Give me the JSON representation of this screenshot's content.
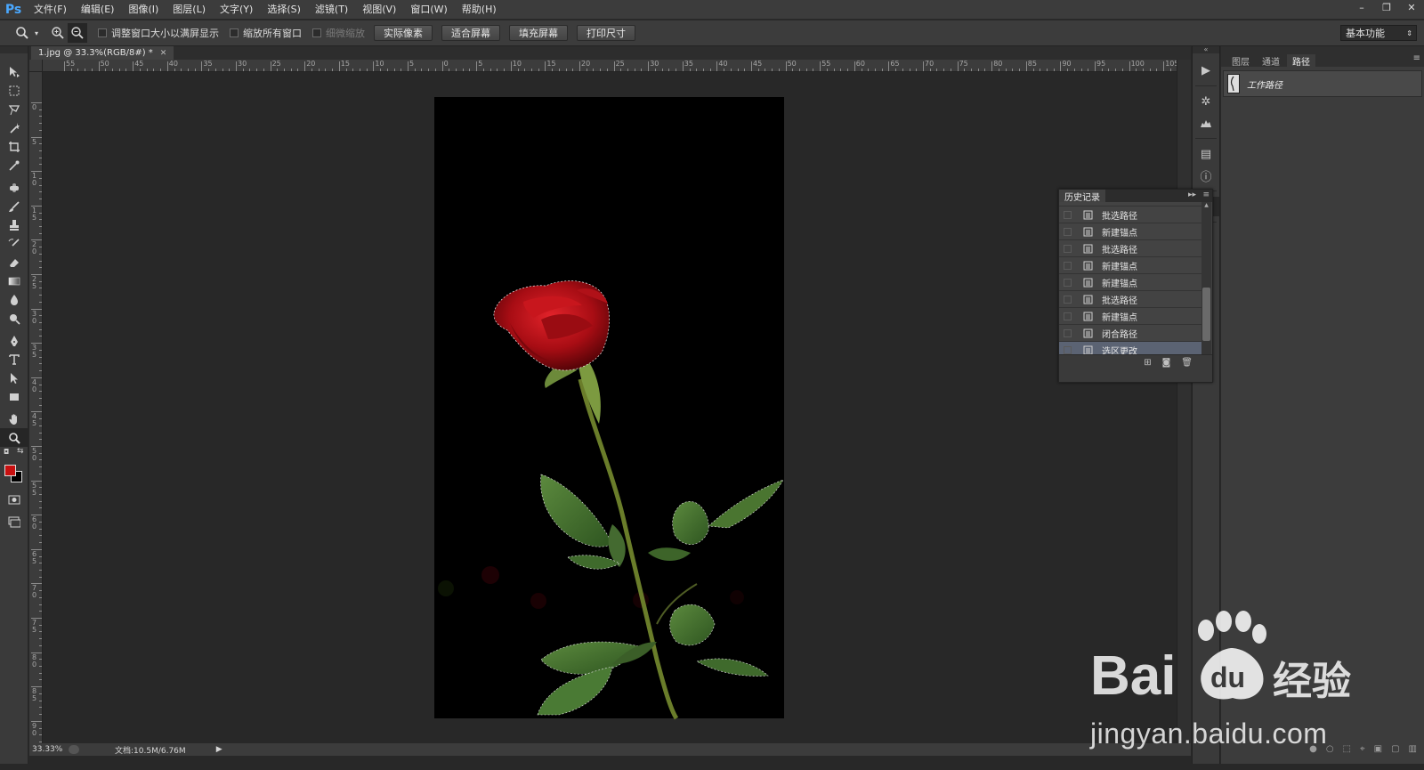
{
  "app": {
    "logo": "Ps"
  },
  "menu": [
    {
      "label": "文件(F)"
    },
    {
      "label": "编辑(E)"
    },
    {
      "label": "图像(I)"
    },
    {
      "label": "图层(L)"
    },
    {
      "label": "文字(Y)"
    },
    {
      "label": "选择(S)"
    },
    {
      "label": "滤镜(T)"
    },
    {
      "label": "视图(V)"
    },
    {
      "label": "窗口(W)"
    },
    {
      "label": "帮助(H)"
    }
  ],
  "window_controls": {
    "minimize": "–",
    "restore": "❐",
    "close": "✕"
  },
  "options": {
    "check_resize_windows": "调整窗口大小以满屏显示",
    "check_zoom_all": "缩放所有窗口",
    "check_scrubby_zoom": "细微缩放",
    "btn_actual_pixels": "实际像素",
    "btn_fit_screen": "适合屏幕",
    "btn_fill_screen": "填充屏幕",
    "btn_print_size": "打印尺寸",
    "workspace": "基本功能"
  },
  "document": {
    "tab_title": "1.jpg @ 33.3%(RGB/8#) *",
    "zoom_level": "33.33%",
    "doc_info": "文档:10.5M/6.76M"
  },
  "ruler": {
    "h_labels": [
      "55",
      "50",
      "45",
      "40",
      "35",
      "30",
      "25",
      "20",
      "15",
      "10",
      "5",
      "0",
      "5",
      "10",
      "15",
      "20",
      "25",
      "30",
      "35",
      "40",
      "45",
      "50",
      "55",
      "60",
      "65",
      "70",
      "75",
      "80",
      "85",
      "90",
      "95",
      "100",
      "105"
    ],
    "v_labels": [
      "0",
      "5",
      "1 0",
      "1 5",
      "2 0",
      "2 5",
      "3 0",
      "3 5",
      "4 0",
      "4 5",
      "5 0",
      "5 5",
      "6 0",
      "6 5",
      "7 0",
      "7 5",
      "8 0",
      "8 5",
      "9 0"
    ]
  },
  "right_panel": {
    "tabs": [
      "图层",
      "通道",
      "路径"
    ],
    "active_tab": "路径",
    "path_name": "工作路径"
  },
  "history": {
    "title": "历史记录",
    "items": [
      {
        "label": "批选路径",
        "selected": false
      },
      {
        "label": "新建锚点",
        "selected": false
      },
      {
        "label": "批选路径",
        "selected": false
      },
      {
        "label": "新建锚点",
        "selected": false
      },
      {
        "label": "新建锚点",
        "selected": false
      },
      {
        "label": "批选路径",
        "selected": false
      },
      {
        "label": "新建锚点",
        "selected": false
      },
      {
        "label": "闭合路径",
        "selected": false
      },
      {
        "label": "选区更改",
        "selected": true
      }
    ]
  },
  "colors": {
    "foreground": "#c81010",
    "background": "#000000",
    "accent_selected": "#5b6373"
  },
  "watermark": {
    "brand": "Bai 经验",
    "url": "jingyan.baidu.com"
  }
}
